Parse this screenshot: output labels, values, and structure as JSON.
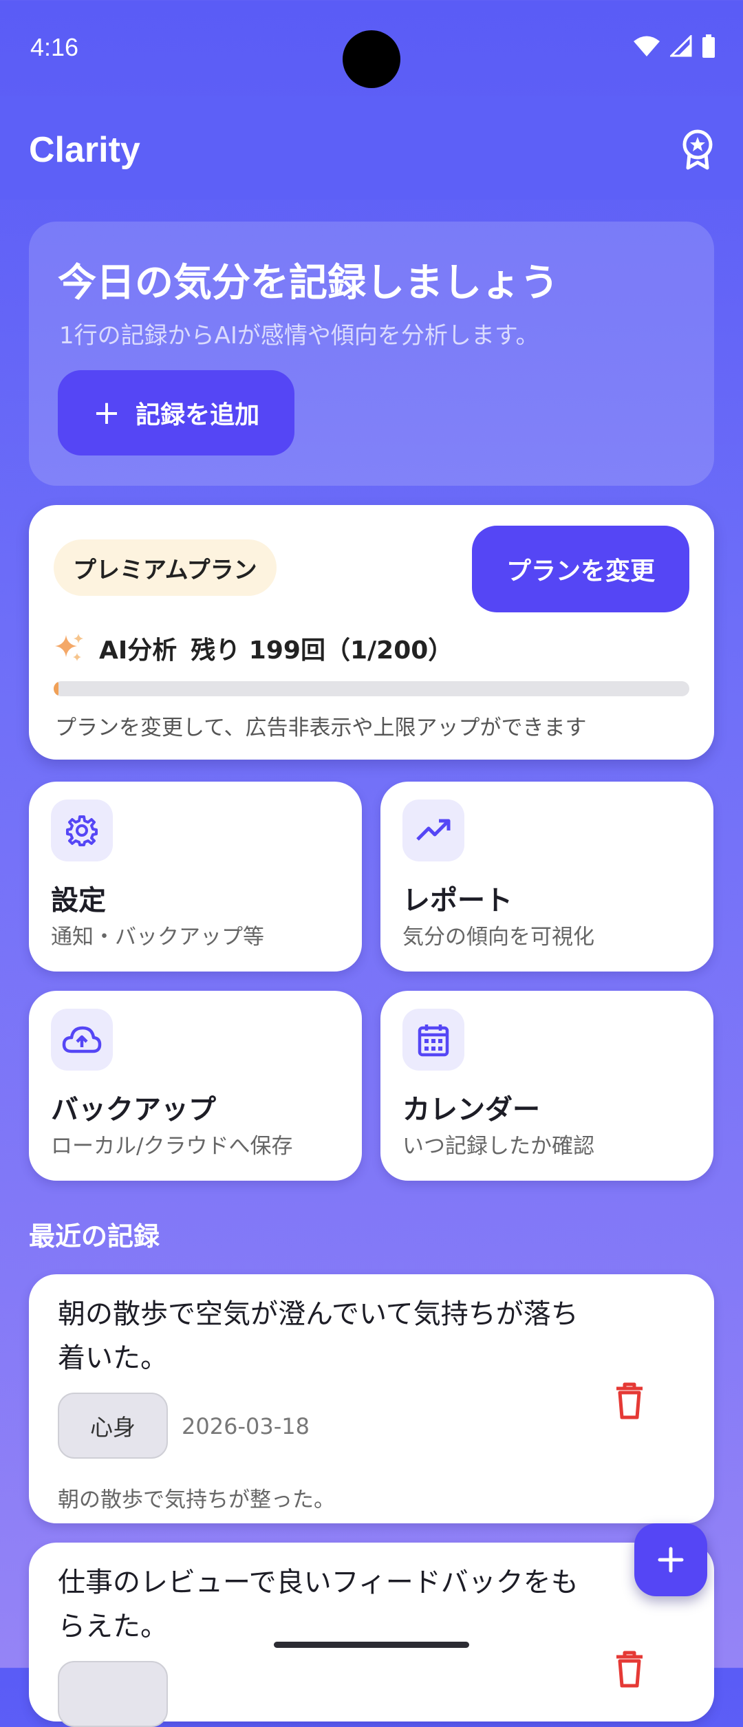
{
  "status": {
    "time": "4:16"
  },
  "appbar": {
    "title": "Clarity",
    "award_icon": "award-icon"
  },
  "hero": {
    "title": "今日の気分を記録しましょう",
    "subtitle": "1行の記録からAIが感情や傾向を分析します。",
    "add_button": "記録を追加"
  },
  "plan": {
    "badge": "プレミアムプラン",
    "change_button": "プランを変更",
    "ai_label": "AI分析",
    "remaining": "残り 199回（1/200）",
    "used_fraction": 0.005,
    "note": "プランを変更して、広告非表示や上限アップができます"
  },
  "tiles": [
    {
      "title": "設定",
      "subtitle": "通知・バックアップ等",
      "icon": "gear-icon"
    },
    {
      "title": "レポート",
      "subtitle": "気分の傾向を可視化",
      "icon": "trending-up-icon"
    },
    {
      "title": "バックアップ",
      "subtitle": "ローカル/クラウドへ保存",
      "icon": "cloud-upload-icon"
    },
    {
      "title": "カレンダー",
      "subtitle": "いつ記録したか確認",
      "icon": "calendar-icon"
    }
  ],
  "recent": {
    "title": "最近の記録",
    "entries": [
      {
        "text": "朝の散歩で空気が澄んでいて気持ちが落ち着いた。",
        "tag": "心身",
        "date": "2026-03-18",
        "summary": "朝の散歩で気持ちが整った。"
      },
      {
        "text": "仕事のレビューで良いフィードバックをもらえた。"
      }
    ]
  },
  "colors": {
    "accent": "#5546f5",
    "danger": "#e53935",
    "progress": "#f0a057"
  }
}
